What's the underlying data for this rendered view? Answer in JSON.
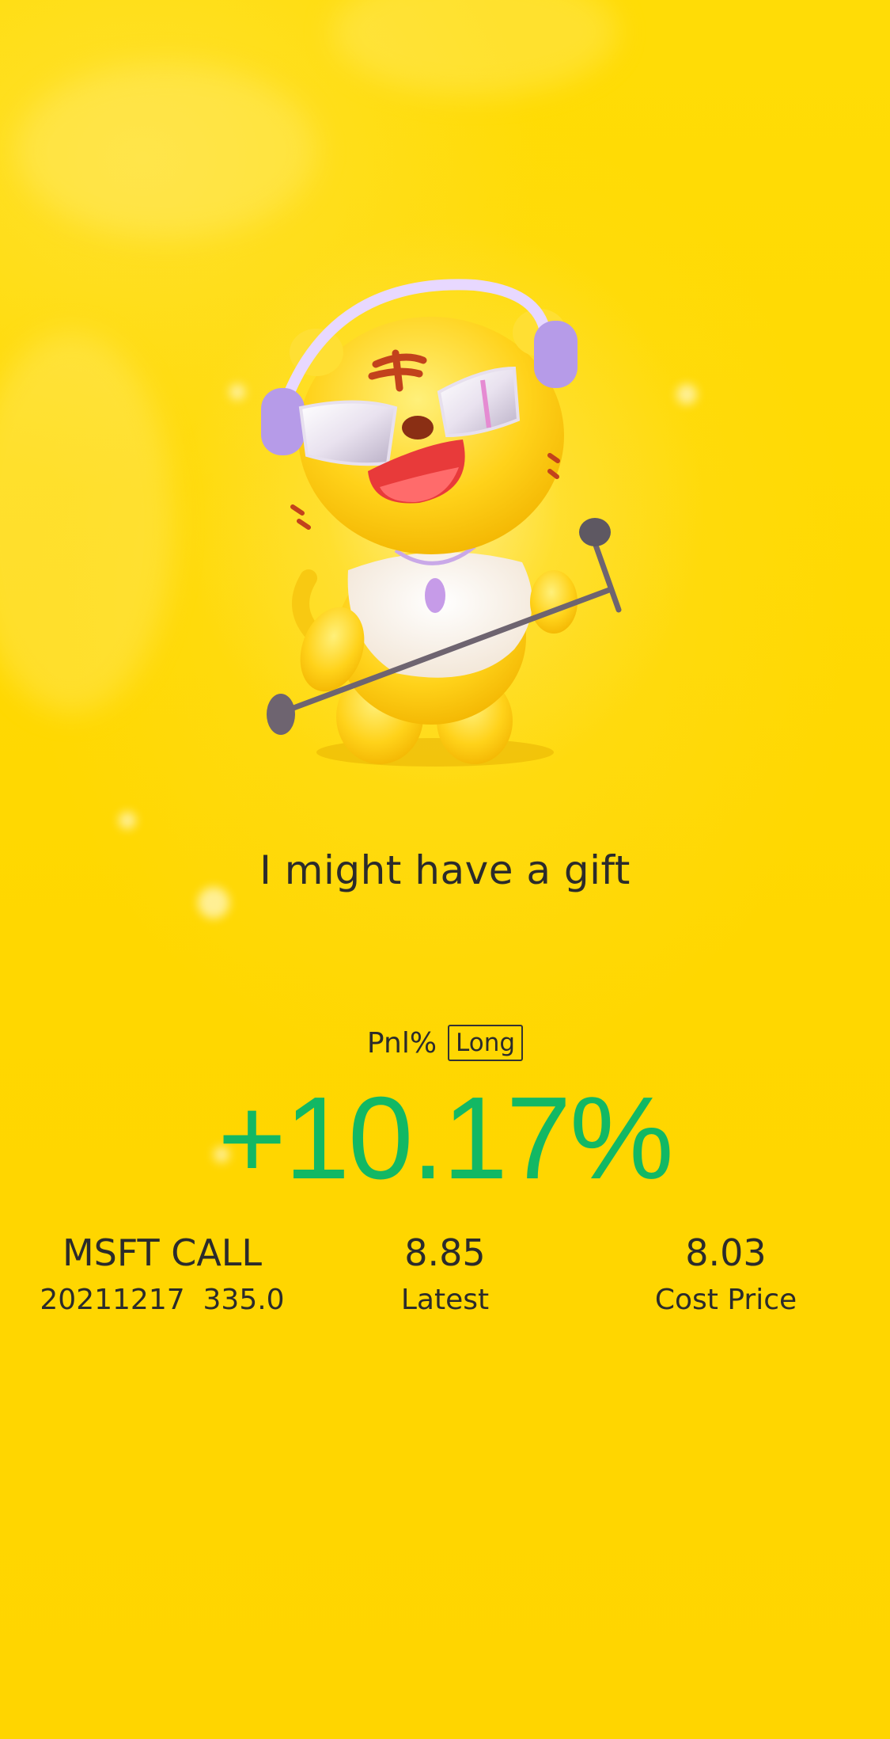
{
  "mascot": {
    "icon": "tiger-mascot-singing-icon"
  },
  "headline": "I might have a gift",
  "pnl": {
    "label": "Pnl%",
    "position_tag": "Long",
    "value": "+10.17%",
    "value_color": "#12B864"
  },
  "stats": {
    "contract_name": "MSFT CALL",
    "contract_detail": "20211217  335.0",
    "latest_value": "8.85",
    "latest_label": "Latest",
    "cost_value": "8.03",
    "cost_label": "Cost Price"
  },
  "colors": {
    "background": "#FFD900",
    "text": "#2b2b2b",
    "positive": "#12B864"
  }
}
